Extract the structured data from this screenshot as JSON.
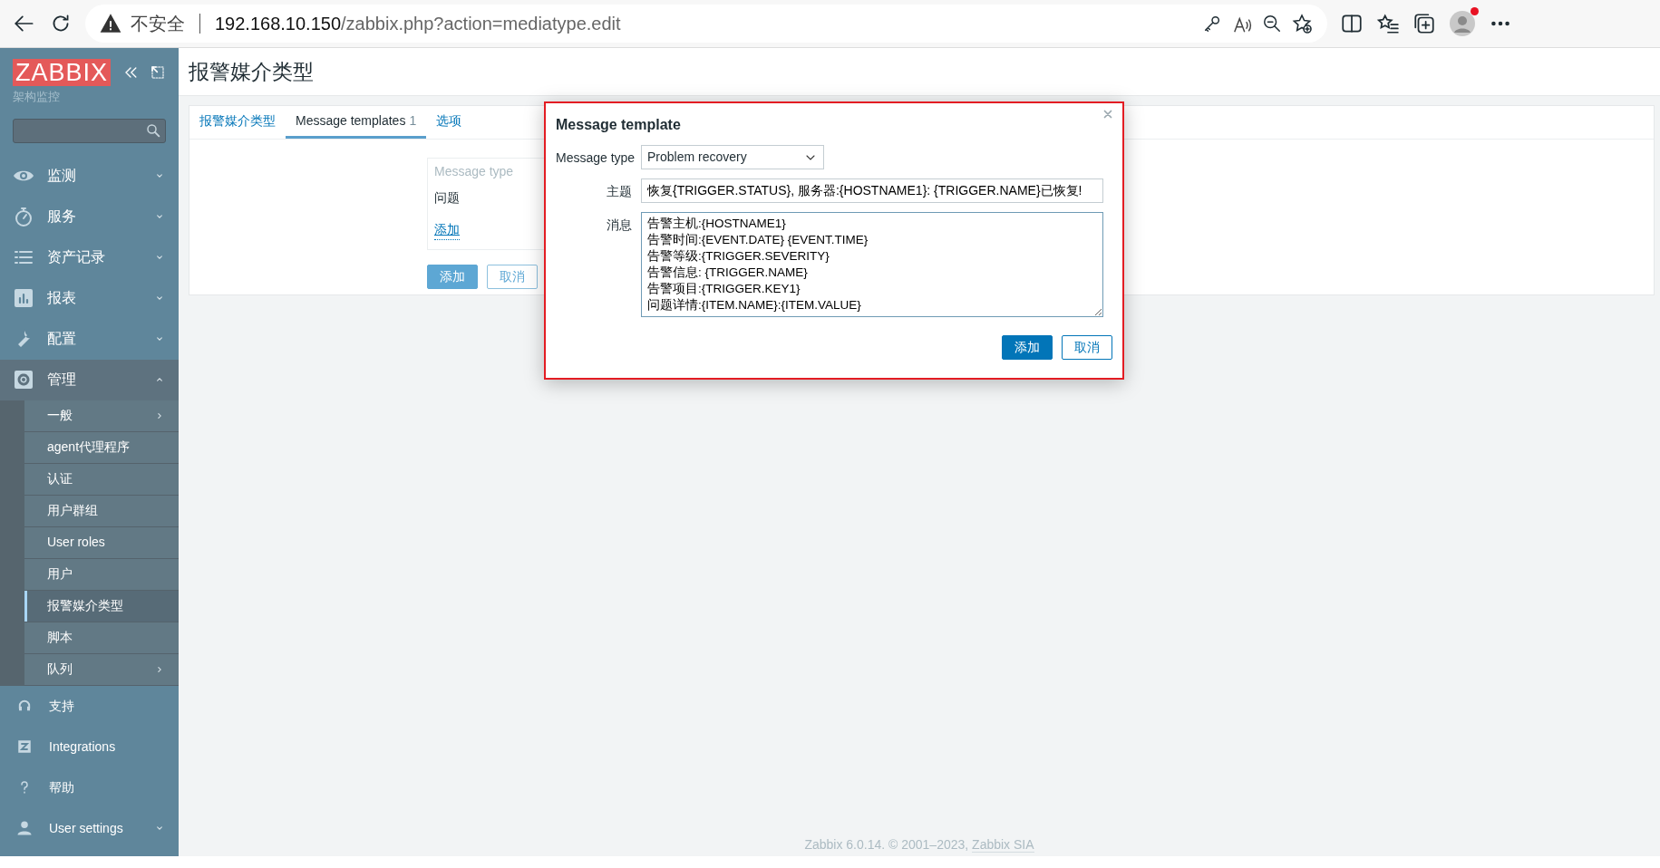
{
  "browser": {
    "security": "不安全",
    "url_host": "192.168.10.150",
    "url_path": "/zabbix.php?action=mediatype.edit",
    "profile_notification": true
  },
  "sidebar": {
    "logo": "ZABBIX",
    "subtitle": "架构监控",
    "menu": [
      {
        "label": "监测",
        "expanded": false
      },
      {
        "label": "服务",
        "expanded": false
      },
      {
        "label": "资产记录",
        "expanded": false
      },
      {
        "label": "报表",
        "expanded": false
      },
      {
        "label": "配置",
        "expanded": false
      },
      {
        "label": "管理",
        "expanded": true,
        "children": [
          {
            "label": "一般",
            "has_submenu": true,
            "selected": false
          },
          {
            "label": "agent代理程序",
            "has_submenu": false,
            "selected": false
          },
          {
            "label": "认证",
            "has_submenu": false,
            "selected": false
          },
          {
            "label": "用户群组",
            "has_submenu": false,
            "selected": false
          },
          {
            "label": "User roles",
            "has_submenu": false,
            "selected": false
          },
          {
            "label": "用户",
            "has_submenu": false,
            "selected": false
          },
          {
            "label": "报警媒介类型",
            "has_submenu": false,
            "selected": true
          },
          {
            "label": "脚本",
            "has_submenu": false,
            "selected": false
          },
          {
            "label": "队列",
            "has_submenu": true,
            "selected": false
          }
        ]
      }
    ],
    "bottom": [
      {
        "label": "支持",
        "has_dropdown": false
      },
      {
        "label": "Integrations",
        "has_dropdown": false
      },
      {
        "label": "帮助",
        "has_dropdown": false
      },
      {
        "label": "User settings",
        "has_dropdown": true
      }
    ]
  },
  "page_title": "报警媒介类型",
  "tabs": [
    {
      "label": "报警媒介类型",
      "selected": false
    },
    {
      "label": "Message templates",
      "count": "1",
      "selected": true
    },
    {
      "label": "选项",
      "selected": false
    }
  ],
  "templates": {
    "column_1": "Message type",
    "rows": [
      {
        "message_type": "问题"
      }
    ],
    "add_link": "添加"
  },
  "form_buttons": [
    {
      "label": "添加",
      "kind": "primary"
    },
    {
      "label": "取消",
      "kind": "secondary"
    }
  ],
  "dialog": {
    "title": "Message template",
    "highlighted": true,
    "message_type": {
      "label": "Message type",
      "value": "Problem recovery"
    },
    "subject": {
      "label": "主题",
      "value": "恢复{TRIGGER.STATUS}, 服务器:{HOSTNAME1}: {TRIGGER.NAME}已恢复!"
    },
    "message": {
      "label": "消息",
      "lines": [
        "告警主机:{HOSTNAME1}",
        "告警时间:{EVENT.DATE} {EVENT.TIME}",
        "告警等级:{TRIGGER.SEVERITY}",
        "告警信息: {TRIGGER.NAME}",
        "告警项目:{TRIGGER.KEY1}",
        "问题详情:{ITEM.NAME}:{ITEM.VALUE}"
      ]
    },
    "buttons": [
      {
        "label": "添加",
        "kind": "primary"
      },
      {
        "label": "取消",
        "kind": "secondary"
      }
    ]
  },
  "footer": {
    "text": "Zabbix 6.0.14. © 2001–2023, ",
    "link": "Zabbix SIA"
  }
}
